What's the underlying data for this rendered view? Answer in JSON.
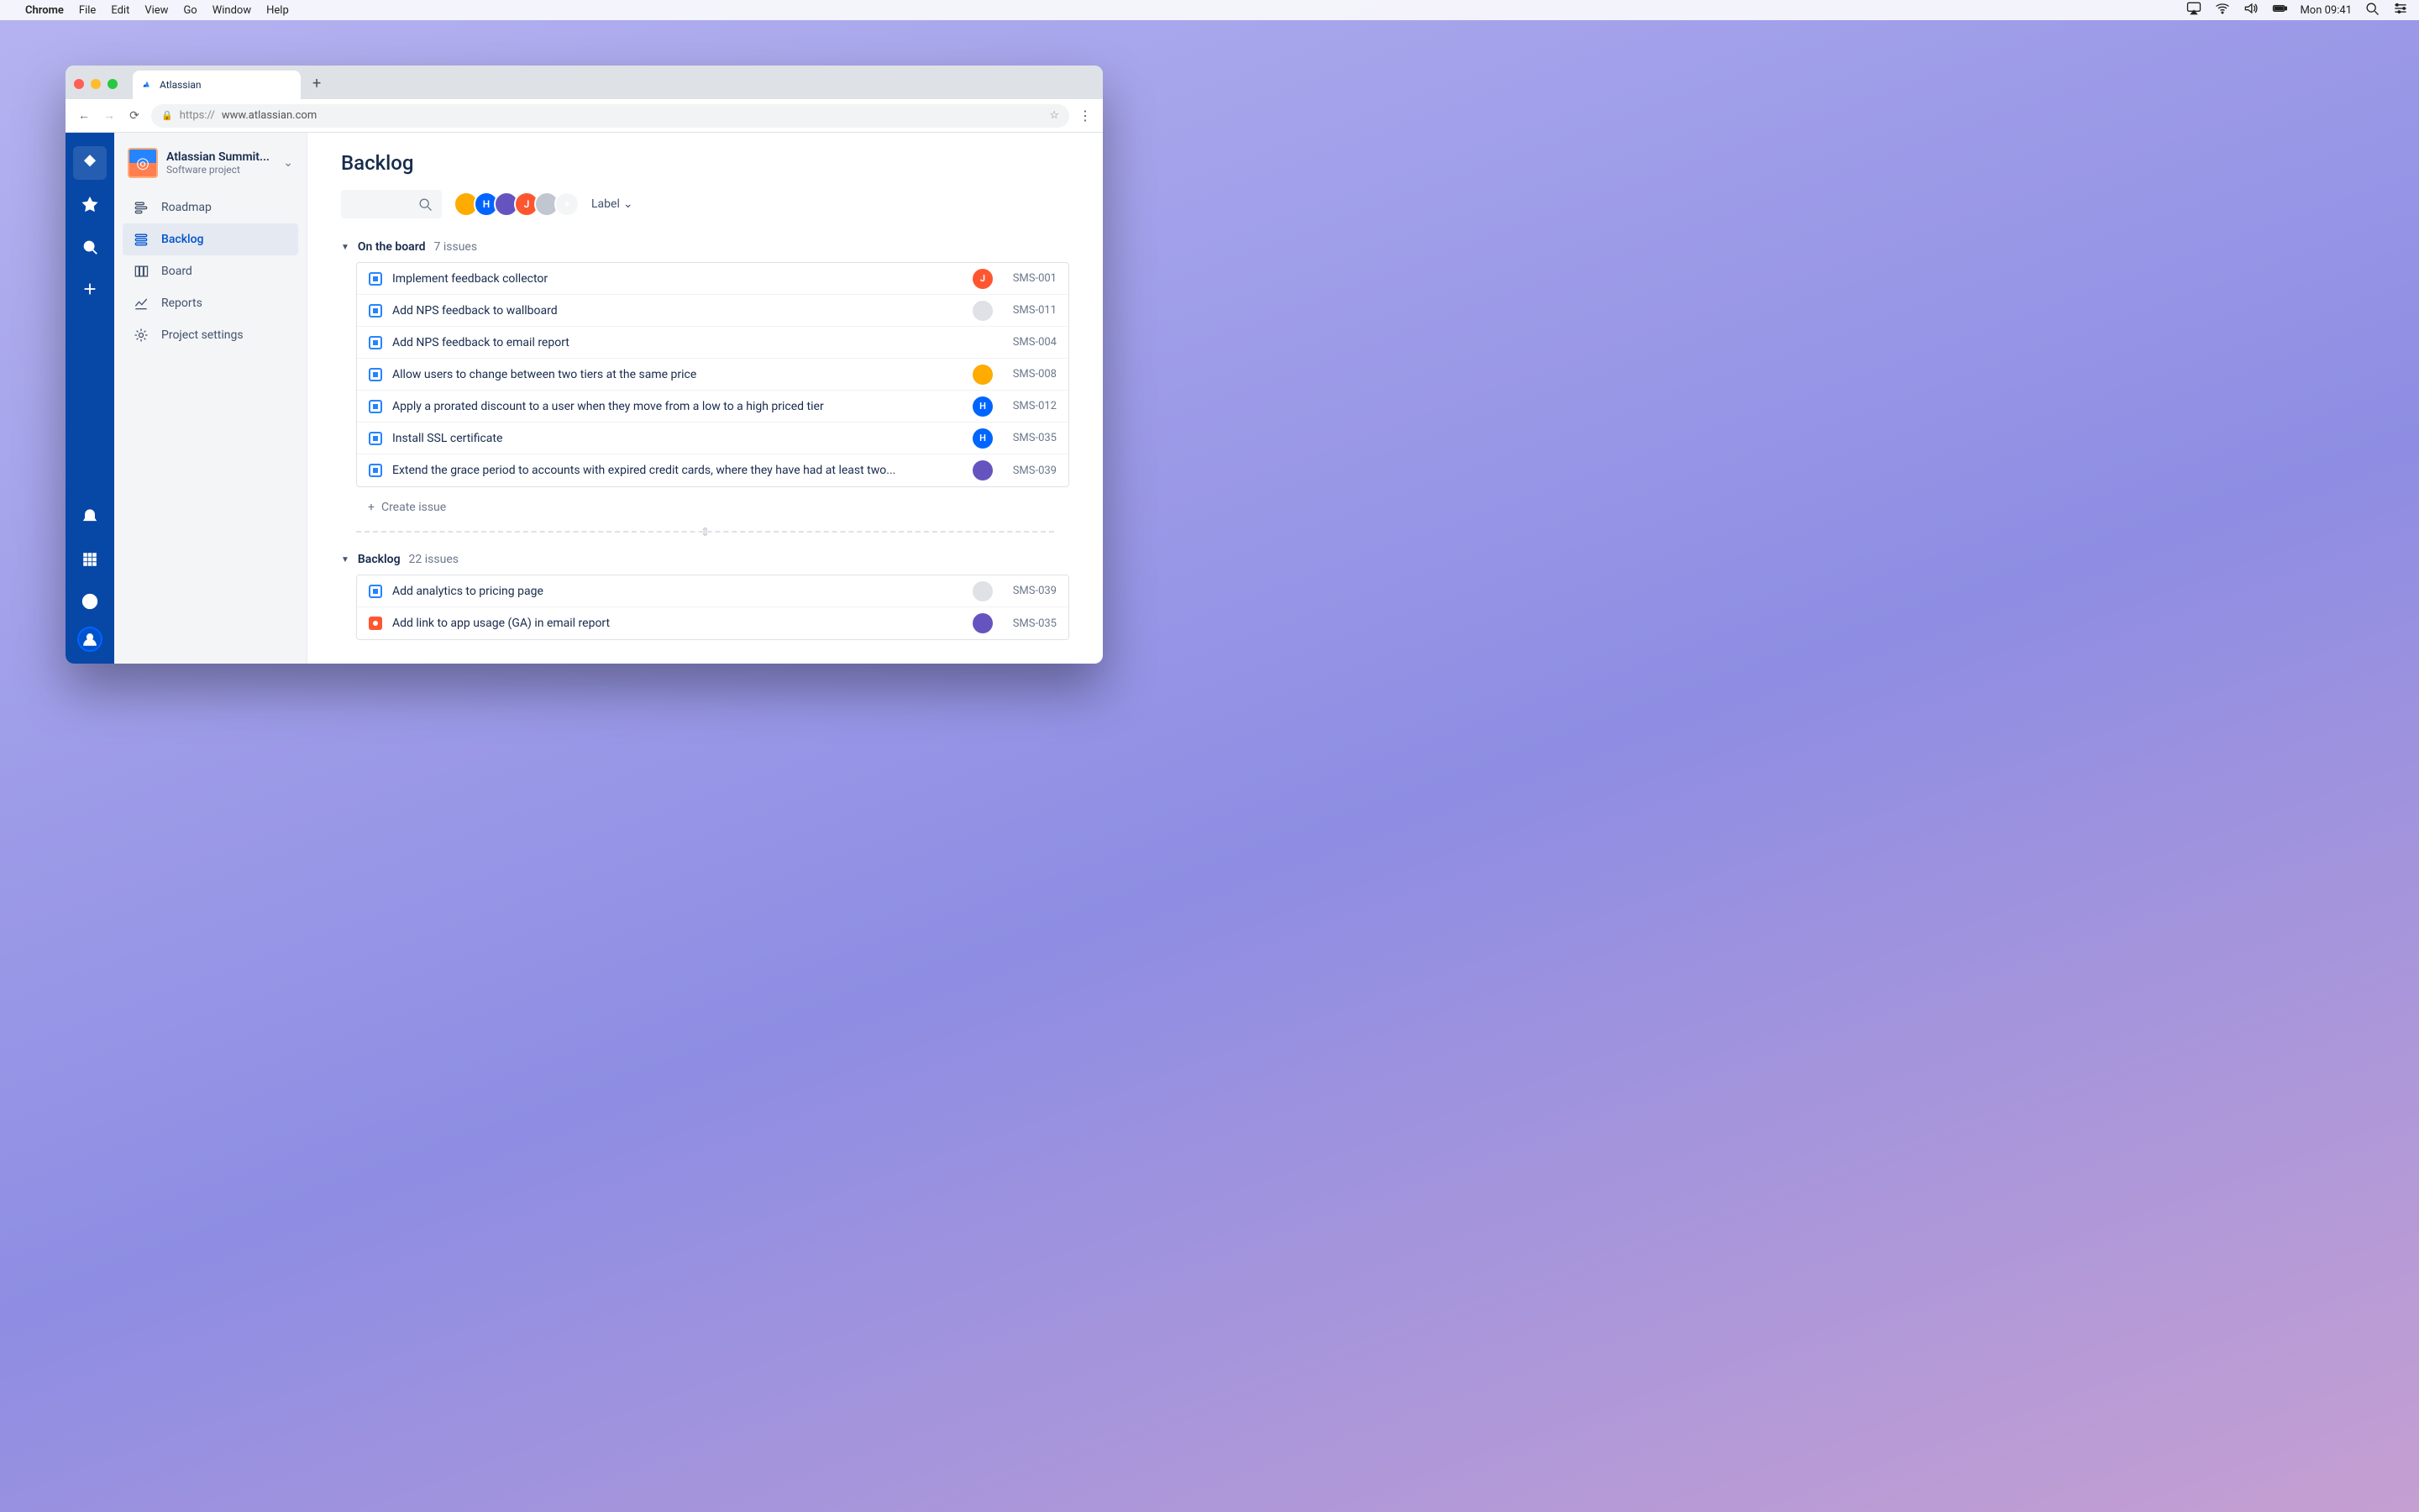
{
  "menubar": {
    "app": "Chrome",
    "items": [
      "File",
      "Edit",
      "View",
      "Go",
      "Window",
      "Help"
    ],
    "clock": "Mon 09:41"
  },
  "browser": {
    "tab_title": "Atlassian",
    "url_proto": "https://",
    "url_host": "www.atlassian.com"
  },
  "project": {
    "name": "Atlassian Summit...",
    "subtitle": "Software project"
  },
  "sidebar": {
    "items": [
      {
        "label": "Roadmap",
        "icon": "roadmap"
      },
      {
        "label": "Backlog",
        "icon": "backlog",
        "active": true
      },
      {
        "label": "Board",
        "icon": "board"
      },
      {
        "label": "Reports",
        "icon": "reports"
      },
      {
        "label": "Project settings",
        "icon": "settings"
      }
    ]
  },
  "page": {
    "title": "Backlog"
  },
  "filters": {
    "label": "Label"
  },
  "avatars": [
    {
      "bg": "#ffab00",
      "text": ""
    },
    {
      "bg": "#0065ff",
      "text": "H"
    },
    {
      "bg": "#6554c0",
      "text": ""
    },
    {
      "bg": "#ff5630",
      "text": "J"
    },
    {
      "bg": "#c1c7d0",
      "text": ""
    }
  ],
  "avatar_add": "+",
  "sections": [
    {
      "name": "On the board",
      "count": "7 issues",
      "create_label": "Create issue",
      "issues": [
        {
          "type": "story",
          "title": "Implement feedback collector",
          "assignee": {
            "bg": "#ff5630",
            "text": "J"
          },
          "key": "SMS-001"
        },
        {
          "type": "story",
          "title": "Add NPS feedback to wallboard",
          "assignee": {
            "bg": "#dfe1e6",
            "text": ""
          },
          "key": "SMS-011"
        },
        {
          "type": "story",
          "title": "Add NPS feedback to email report",
          "assignee": null,
          "key": "SMS-004"
        },
        {
          "type": "story",
          "title": "Allow users to change between two tiers at the same price",
          "assignee": {
            "bg": "#ffab00",
            "text": ""
          },
          "key": "SMS-008"
        },
        {
          "type": "story",
          "title": "Apply a prorated discount to a user when they move from a low to a high priced tier",
          "assignee": {
            "bg": "#0065ff",
            "text": "H"
          },
          "key": "SMS-012"
        },
        {
          "type": "story",
          "title": "Install SSL certificate",
          "assignee": {
            "bg": "#0065ff",
            "text": "H"
          },
          "key": "SMS-035"
        },
        {
          "type": "story",
          "title": "Extend the grace period to accounts with expired credit cards, where they have had at least two...",
          "assignee": {
            "bg": "#6554c0",
            "text": ""
          },
          "key": "SMS-039"
        }
      ]
    },
    {
      "name": "Backlog",
      "count": "22 issues",
      "issues": [
        {
          "type": "story",
          "title": "Add analytics to pricing page",
          "assignee": {
            "bg": "#dfe1e6",
            "text": ""
          },
          "key": "SMS-039"
        },
        {
          "type": "bug",
          "title": "Add link to app usage (GA) in email report",
          "assignee": {
            "bg": "#6554c0",
            "text": ""
          },
          "key": "SMS-035"
        }
      ]
    }
  ]
}
